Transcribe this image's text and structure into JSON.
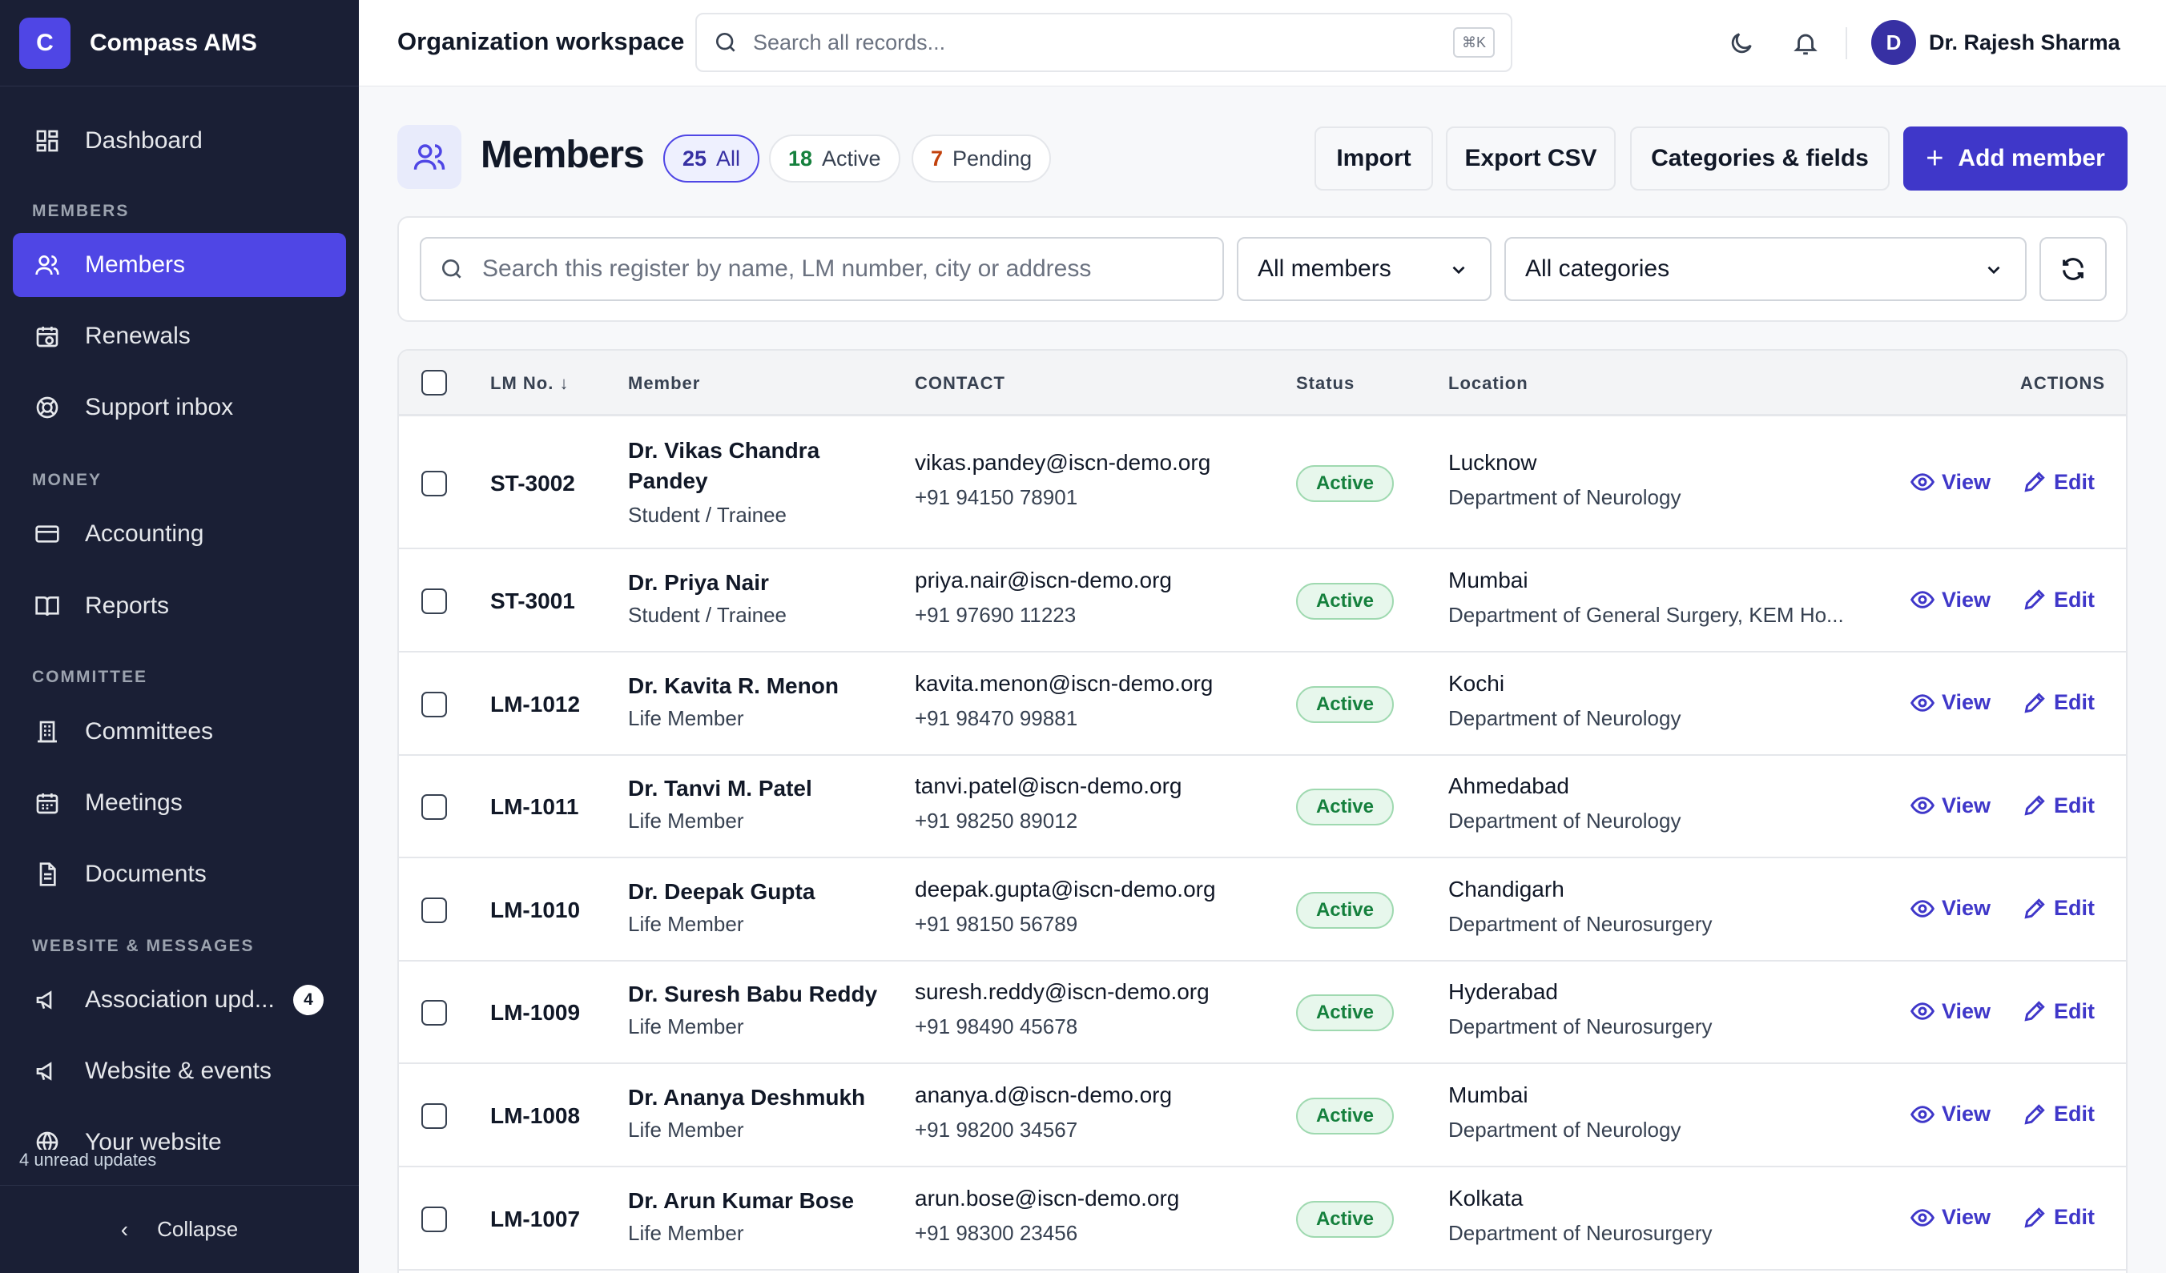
{
  "app": {
    "logo_letter": "C",
    "name": "Compass AMS"
  },
  "sidebar": {
    "sections": {
      "members": "MEMBERS",
      "money": "MONEY",
      "committee": "COMMITTEE",
      "website": "WEBSITE & MESSAGES"
    },
    "items": [
      {
        "label": "Dashboard",
        "icon": "dashboard-icon"
      },
      {
        "label": "Members",
        "icon": "users-icon",
        "active": true
      },
      {
        "label": "Renewals",
        "icon": "calendar-refresh-icon"
      },
      {
        "label": "Support inbox",
        "icon": "lifebuoy-icon"
      },
      {
        "label": "Accounting",
        "icon": "credit-card-icon"
      },
      {
        "label": "Reports",
        "icon": "book-open-icon"
      },
      {
        "label": "Committees",
        "icon": "building-icon"
      },
      {
        "label": "Meetings",
        "icon": "calendar-icon"
      },
      {
        "label": "Documents",
        "icon": "document-icon"
      },
      {
        "label": "Association upd...",
        "icon": "megaphone-icon",
        "badge": "4"
      },
      {
        "label": "Website & events",
        "icon": "megaphone-icon"
      },
      {
        "label": "Your website",
        "icon": "globe-icon"
      }
    ],
    "unread_note": "4 unread updates",
    "collapse_label": "Collapse"
  },
  "topbar": {
    "workspace_title": "Organization workspace",
    "search_placeholder": "Search all records...",
    "search_shortcut": "⌘K",
    "user_initial": "D",
    "user_name": "Dr. Rajesh Sharma"
  },
  "page": {
    "title": "Members",
    "pills": [
      {
        "count": "25",
        "label": "All",
        "selected": true,
        "color": "#3730a3"
      },
      {
        "count": "18",
        "label": "Active",
        "color": "#15803d"
      },
      {
        "count": "7",
        "label": "Pending",
        "color": "#c2410c"
      }
    ],
    "buttons": {
      "import": "Import",
      "export": "Export CSV",
      "categories": "Categories & fields",
      "add": "Add member"
    }
  },
  "filters": {
    "search_placeholder": "Search this register by name, LM number, city or address",
    "member_filter": "All members",
    "category_filter": "All categories"
  },
  "table": {
    "headers": {
      "lm": "LM No.",
      "member": "Member",
      "contact": "CONTACT",
      "status": "Status",
      "location": "Location",
      "actions": "ACTIONS"
    },
    "view_label": "View",
    "edit_label": "Edit",
    "rows": [
      {
        "lm": "ST-3002",
        "name": "Dr. Vikas Chandra Pandey",
        "category": "Student / Trainee",
        "email": "vikas.pandey@iscn-demo.org",
        "phone": "+91 94150 78901",
        "status": "Active",
        "city": "Lucknow",
        "dept": "Department of Neurology"
      },
      {
        "lm": "ST-3001",
        "name": "Dr. Priya Nair",
        "category": "Student / Trainee",
        "email": "priya.nair@iscn-demo.org",
        "phone": "+91 97690 11223",
        "status": "Active",
        "city": "Mumbai",
        "dept": "Department of General Surgery, KEM Ho..."
      },
      {
        "lm": "LM-1012",
        "name": "Dr. Kavita R. Menon",
        "category": "Life Member",
        "email": "kavita.menon@iscn-demo.org",
        "phone": "+91 98470 99881",
        "status": "Active",
        "city": "Kochi",
        "dept": "Department of Neurology"
      },
      {
        "lm": "LM-1011",
        "name": "Dr. Tanvi M. Patel",
        "category": "Life Member",
        "email": "tanvi.patel@iscn-demo.org",
        "phone": "+91 98250 89012",
        "status": "Active",
        "city": "Ahmedabad",
        "dept": "Department of Neurology"
      },
      {
        "lm": "LM-1010",
        "name": "Dr. Deepak Gupta",
        "category": "Life Member",
        "email": "deepak.gupta@iscn-demo.org",
        "phone": "+91 98150 56789",
        "status": "Active",
        "city": "Chandigarh",
        "dept": "Department of Neurosurgery"
      },
      {
        "lm": "LM-1009",
        "name": "Dr. Suresh Babu Reddy",
        "category": "Life Member",
        "email": "suresh.reddy@iscn-demo.org",
        "phone": "+91 98490 45678",
        "status": "Active",
        "city": "Hyderabad",
        "dept": "Department of Neurosurgery"
      },
      {
        "lm": "LM-1008",
        "name": "Dr. Ananya Deshmukh",
        "category": "Life Member",
        "email": "ananya.d@iscn-demo.org",
        "phone": "+91 98200 34567",
        "status": "Active",
        "city": "Mumbai",
        "dept": "Department of Neurology"
      },
      {
        "lm": "LM-1007",
        "name": "Dr. Arun Kumar Bose",
        "category": "Life Member",
        "email": "arun.bose@iscn-demo.org",
        "phone": "+91 98300 23456",
        "status": "Active",
        "city": "Kolkata",
        "dept": "Department of Neurosurgery"
      }
    ]
  },
  "colors": {
    "accent": "#4f46e5",
    "sidebar_bg": "#1a1f35",
    "active_green": "#15803d"
  }
}
